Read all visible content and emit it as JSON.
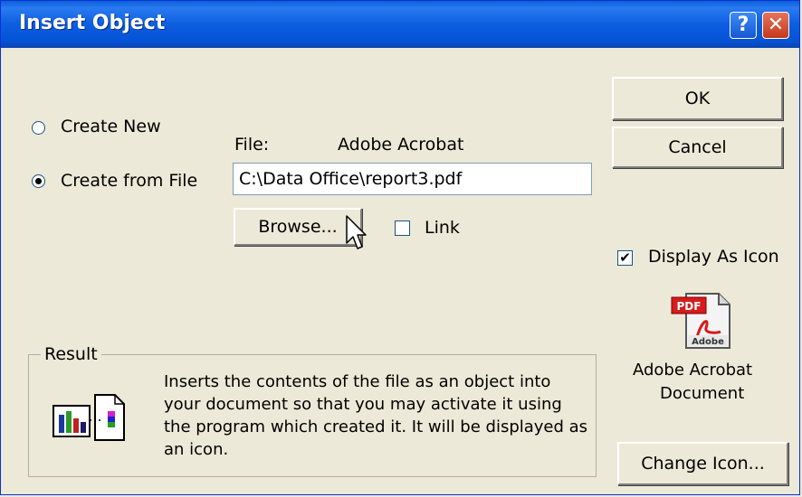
{
  "window": {
    "title": "Insert Object",
    "help_label": "?",
    "close_label": "✕"
  },
  "mode": {
    "create_new_label": "Create New",
    "create_from_file_label": "Create from File",
    "selected": "Create from File"
  },
  "file": {
    "label": "File:",
    "type_label": "Adobe Acrobat",
    "value": "C:\\Data Office\\report3.pdf",
    "browse_label": "Browse...",
    "link_label": "Link",
    "link_checked": false
  },
  "buttons": {
    "ok_label": "OK",
    "cancel_label": "Cancel",
    "change_icon_label": "Change Icon..."
  },
  "display_icon": {
    "label": "Display As Icon",
    "checked": true,
    "icon_caption_line1": "Adobe Acrobat",
    "icon_caption_line2": "Document",
    "icon_badge": "PDF",
    "icon_footer": "Adobe"
  },
  "result": {
    "legend": "Result",
    "text": "Inserts the contents of the file as an object into your document so that you may activate it using the program which created it.  It will be displayed as an icon."
  },
  "icons": [
    "help-icon",
    "close-icon",
    "pdf-file-icon",
    "embedded-object-icon",
    "mouse-cursor-icon"
  ]
}
